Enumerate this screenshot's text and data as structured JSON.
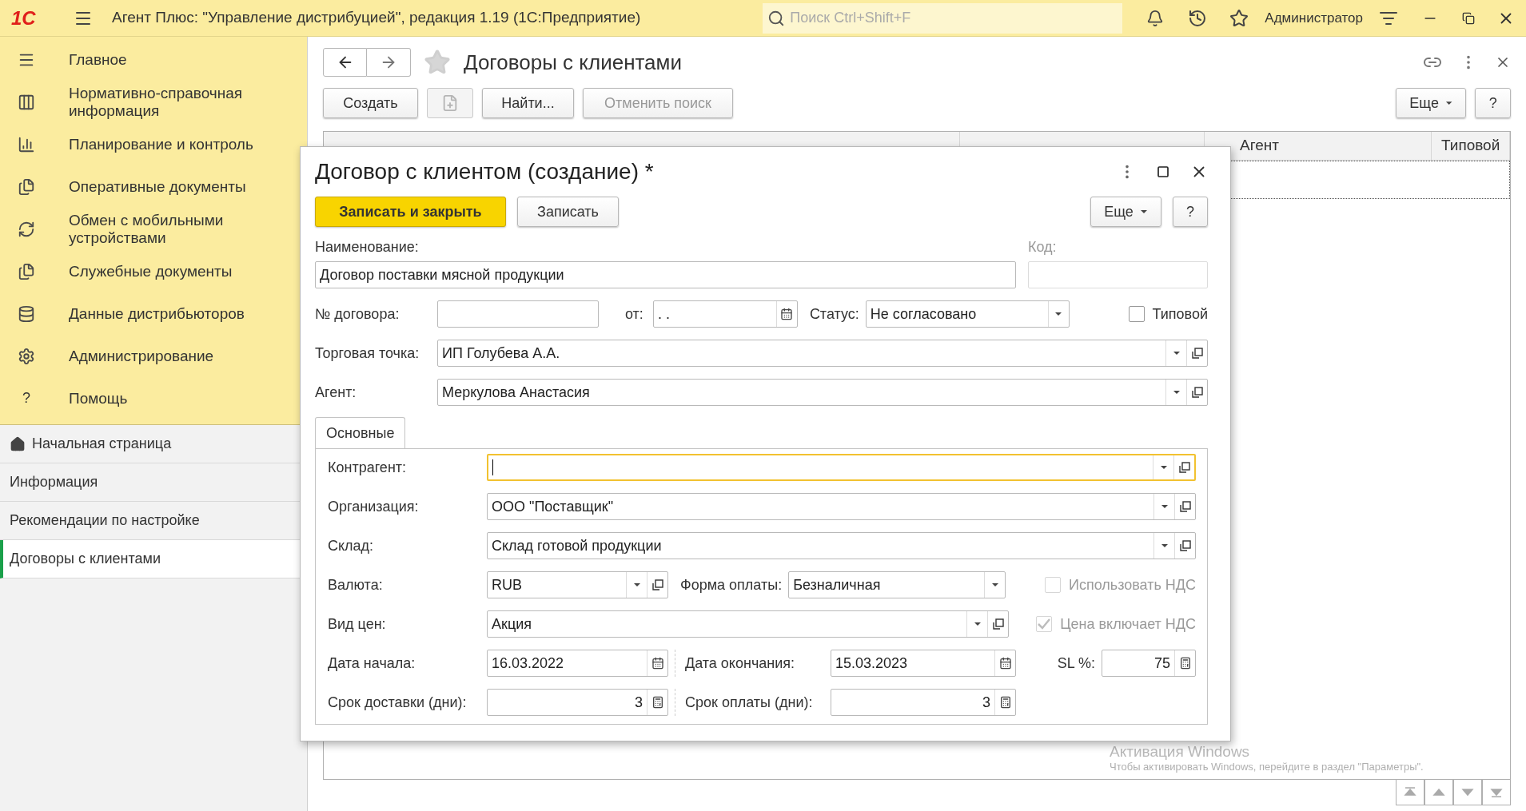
{
  "app_bar": {
    "logo": "1С",
    "title": "Агент Плюс: \"Управление дистрибуцией\", редакция 1.19  (1С:Предприятие)",
    "search_placeholder": "Поиск Ctrl+Shift+F",
    "user": "Администратор"
  },
  "sidebar": {
    "sections": [
      {
        "label": "Главное"
      },
      {
        "label": "Нормативно-справочная информация"
      },
      {
        "label": "Планирование и контроль"
      },
      {
        "label": "Оперативные документы"
      },
      {
        "label": "Обмен с мобильными устройствами"
      },
      {
        "label": "Служебные документы"
      },
      {
        "label": "Данные дистрибьюторов"
      },
      {
        "label": "Администрирование"
      },
      {
        "label": "Помощь",
        "glyph": "?"
      }
    ],
    "open_windows": [
      {
        "label": "Начальная страница",
        "home": true,
        "selected": false
      },
      {
        "label": "Информация",
        "home": false,
        "selected": false
      },
      {
        "label": "Рекомендации по настройке",
        "home": false,
        "selected": false
      },
      {
        "label": "Договоры с клиентами",
        "home": false,
        "selected": true
      }
    ]
  },
  "list_form": {
    "title": "Договоры с клиентами",
    "toolbar": [
      {
        "kind": "text",
        "label": "Создать",
        "disabled": false
      },
      {
        "kind": "icon",
        "disabled": true
      },
      {
        "kind": "text",
        "label": "Найти...",
        "disabled": false
      },
      {
        "kind": "text",
        "label": "Отменить поиск",
        "disabled": true
      }
    ],
    "more_button": "Еще",
    "help_button": "?",
    "visible_column_headers": [
      "Агент",
      "Типовой"
    ]
  },
  "dialog": {
    "title": "Договор с клиентом (создание) *",
    "save_close_button": "Записать и закрыть",
    "save_button": "Записать",
    "more_button": "Еще",
    "help_button": "?",
    "name": {
      "label": "Наименование:",
      "value": "Договор поставки мясной продукции"
    },
    "code": {
      "label": "Код:",
      "disabled": true
    },
    "number": {
      "label": "№ договора:"
    },
    "date": {
      "label": "от:",
      "value": " .  . "
    },
    "status": {
      "label": "Статус:",
      "value": "Не согласовано"
    },
    "template": {
      "label": "Типовой",
      "checked": false,
      "disabled": false
    },
    "outlet": {
      "label": "Торговая точка:",
      "value": "ИП Голубева А.А."
    },
    "agent": {
      "label": "Агент:",
      "value": "Меркулова Анастасия"
    },
    "tabs": [
      {
        "label": "Основные",
        "selected": true
      }
    ],
    "counterparty": {
      "label": "Контрагент:",
      "focused": true
    },
    "organization": {
      "label": "Организация:",
      "value": "ООО \"Поставщик\""
    },
    "warehouse": {
      "label": "Склад:",
      "value": "Склад готовой продукции"
    },
    "currency": {
      "label": "Валюта:",
      "value": "RUB"
    },
    "payment_form": {
      "label": "Форма оплаты:",
      "value": "Безналичная"
    },
    "use_vat": {
      "label": "Использовать НДС",
      "checked": false,
      "disabled": true
    },
    "price_type": {
      "label": "Вид цен:",
      "value": "Акция"
    },
    "price_includes_vat": {
      "label": "Цена включает НДС",
      "checked": true,
      "disabled": true
    },
    "start_date": {
      "label": "Дата начала:",
      "value": "16.03.2022"
    },
    "end_date": {
      "label": "Дата окончания:",
      "value": "15.03.2023"
    },
    "sl": {
      "label": "SL %:",
      "value": "75"
    },
    "delivery_days": {
      "label": "Срок доставки (дни):",
      "value": "3"
    },
    "payment_days": {
      "label": "Срок оплаты (дни):",
      "value": "3"
    }
  },
  "os_notice": {
    "title": "Активация Windows",
    "text": "Чтобы активировать Windows, перейдите в раздел \"Параметры\"."
  }
}
